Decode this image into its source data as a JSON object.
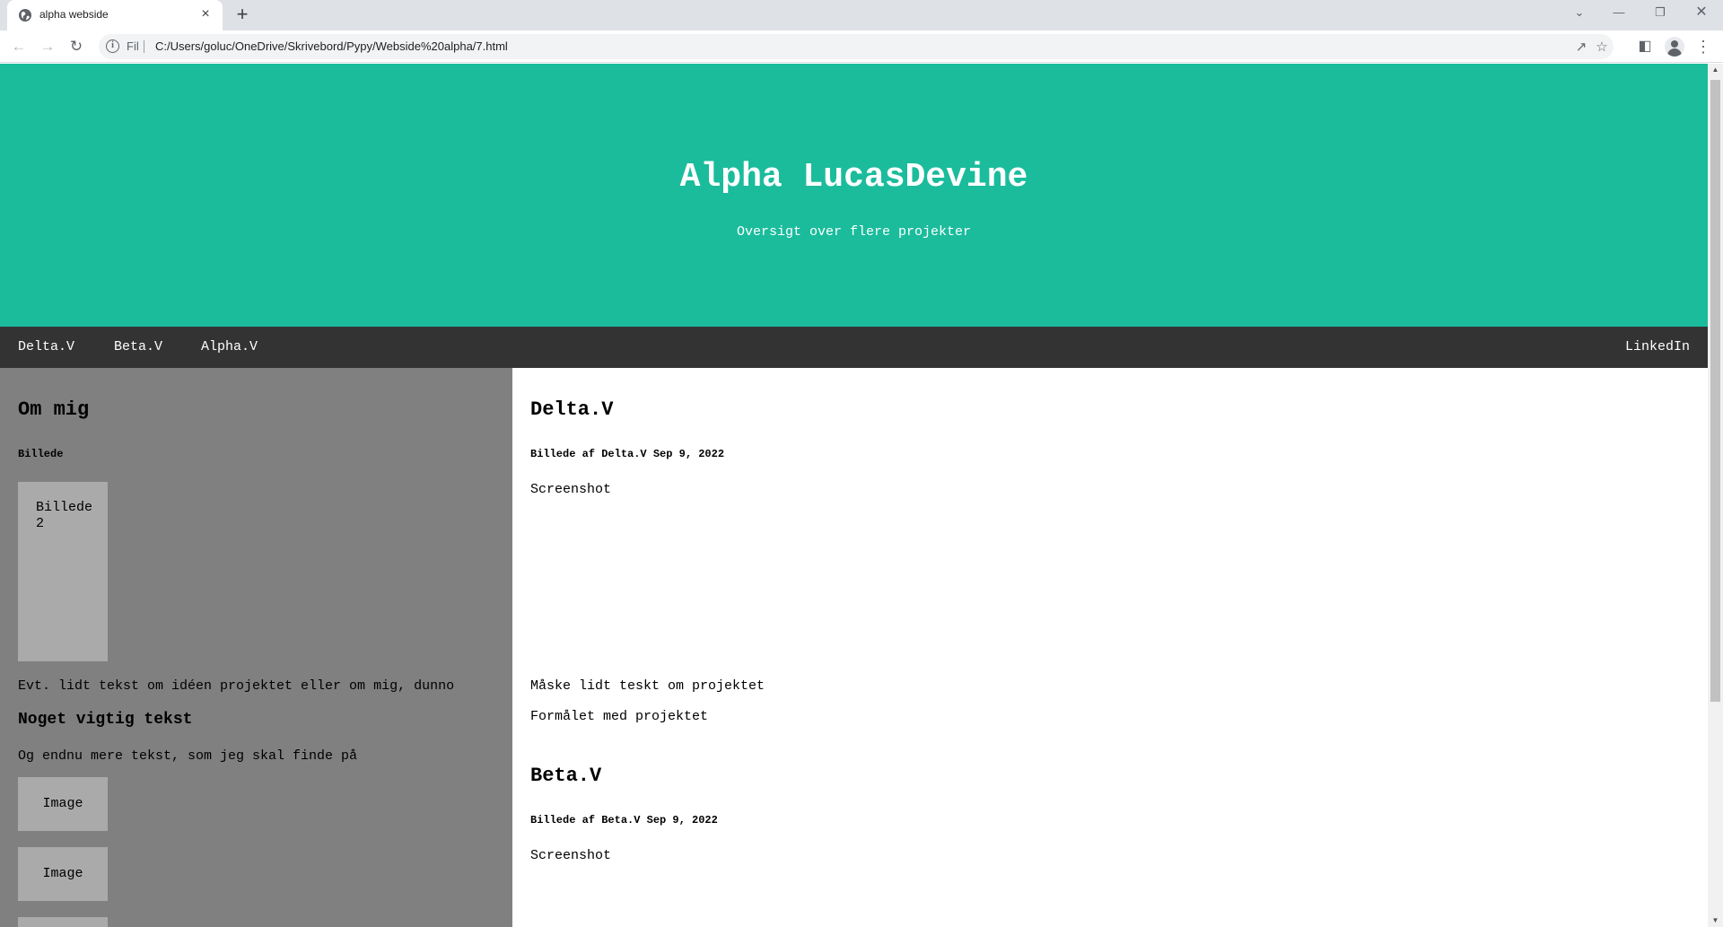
{
  "browser": {
    "tab_title": "alpha webside",
    "new_tab": "+",
    "close": "×",
    "scheme": "Fil",
    "url": "C:/Users/goluc/OneDrive/Skrivebord/Pypy/Webside%20alpha/7.html"
  },
  "page": {
    "header": {
      "title": "Alpha LucasDevine",
      "subtitle": "Oversigt over flere projekter"
    },
    "nav": {
      "links": [
        "Delta.V",
        "Beta.V",
        "Alpha.V"
      ],
      "right_link": "LinkedIn"
    },
    "sidebar": {
      "heading": "Om mig",
      "image_label": "Billede",
      "image_box_text": "Billede 2",
      "paragraph": "Evt. lidt tekst om idéen projektet eller om mig, dunno",
      "subheading": "Noget vigtig tekst",
      "paragraph2": "Og endnu mere tekst, som jeg skal finde på",
      "images": [
        "Image",
        "Image"
      ]
    },
    "posts": [
      {
        "title": "Delta.V",
        "meta": "Billede af Delta.V Sep 9, 2022",
        "placeholder": "Screenshot",
        "text1": "Måske lidt teskt om projektet",
        "text2": "Formålet med projektet"
      },
      {
        "title": "Beta.V",
        "meta": "Billede af Beta.V Sep 9, 2022",
        "placeholder": "Screenshot"
      }
    ]
  },
  "colors": {
    "header_bg": "#1abc9c",
    "nav_bg": "#333333",
    "sidebar_bg": "#808080",
    "placeholder_bg": "#aaaaaa"
  }
}
